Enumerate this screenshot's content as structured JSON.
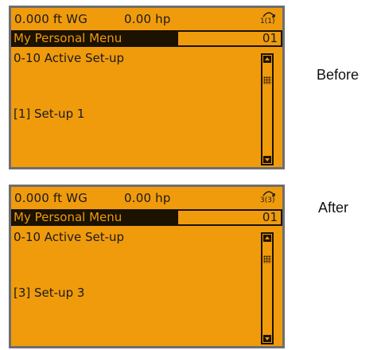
{
  "panels": [
    {
      "id": "before",
      "caption": "Before",
      "status": {
        "pressure": "0.000 ft WG",
        "power": "0.00 hp",
        "setup_icon": "setup-icon",
        "setup_indicator": "1(1)"
      },
      "menu": {
        "title": "My Personal Menu",
        "index": "01"
      },
      "parameter": {
        "title": "0-10 Active Set-up",
        "value": "[1] Set-up 1"
      },
      "scroll": {
        "position": 0.0
      }
    },
    {
      "id": "after",
      "caption": "After",
      "status": {
        "pressure": "0.000 ft WG",
        "power": "0.00 hp",
        "setup_icon": "setup-icon",
        "setup_indicator": "3(3)"
      },
      "menu": {
        "title": "My Personal Menu",
        "index": "01"
      },
      "parameter": {
        "title": "0-10 Active Set-up",
        "value": "[3] Set-up 3"
      },
      "scroll": {
        "position": 0.0
      }
    }
  ],
  "colors": {
    "display_bg": "#f09b0c",
    "text": "#1a1a1a",
    "bezel": "#6e6e6e"
  }
}
